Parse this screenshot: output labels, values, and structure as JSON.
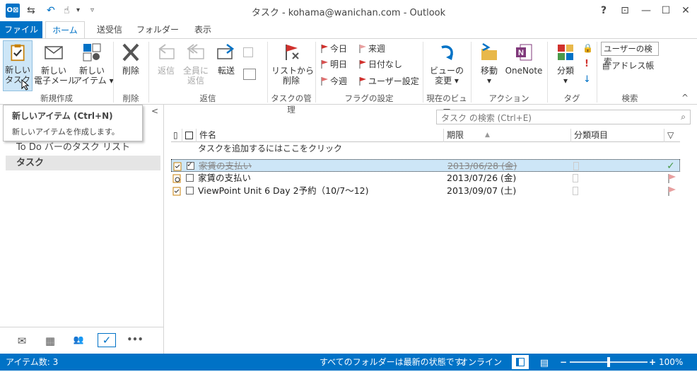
{
  "window": {
    "title": "タスク - kohama@wanichan.com - Outlook",
    "app_icon": "O⊠",
    "buttons": {
      "help": "?",
      "restore_ribbon": "⊡",
      "minimize": "—",
      "maximize": "☐",
      "close": "✕"
    }
  },
  "quick_access": {
    "sendrecv": "⇆",
    "undo": "↶",
    "touch": "☝",
    "more": "▾",
    "customize": "▿"
  },
  "tabs": [
    "ファイル",
    "ホーム",
    "送受信",
    "フォルダー",
    "表示"
  ],
  "ribbon": {
    "new_group": {
      "label": "新規作成",
      "new_task": "新しい\nタスク",
      "new_mail": "新しい\n電子メール",
      "new_item": "新しい\nアイテム ▾"
    },
    "delete_group": {
      "label": "削除",
      "delete": "削除"
    },
    "reply_group": {
      "label": "返信",
      "reply": "返信",
      "reply_all": "全員に\n返信",
      "forward": "転送"
    },
    "manage_group": {
      "label": "タスクの管理",
      "remove_from_list": "リストから\n削除"
    },
    "flag_group": {
      "label": "フラグの設定",
      "today": "今日",
      "tomorrow": "明日",
      "this_week": "今週",
      "next_week": "来週",
      "no_date": "日付なし",
      "custom": "ユーザー設定"
    },
    "view_group": {
      "label": "現在のビュー",
      "change_view": "ビューの\n変更 ▾"
    },
    "actions_group": {
      "label": "アクション",
      "move": "移動\n▾",
      "onenote": "OneNote"
    },
    "tags_group": {
      "label": "タグ",
      "categorize": "分類\n▾"
    },
    "search_group": {
      "label": "検索",
      "search_people": "ユーザーの検索",
      "address_book": "アドレス帳"
    },
    "collapse": "^"
  },
  "tooltip": {
    "title": "新しいアイテム (Ctrl+N)",
    "description": "新しいアイテムを作成します。"
  },
  "left_pane": {
    "collapse": "<",
    "items": [
      "To Do バーのタスク リスト",
      "タスク"
    ]
  },
  "nav_bar": [
    "✉",
    "▦",
    "👥",
    "✓",
    "•••"
  ],
  "search": {
    "placeholder": "タスク の検索 (Ctrl+E)",
    "icon": "search-icon"
  },
  "table": {
    "headers": {
      "subject": "件名",
      "due": "期限",
      "sort_icon": "▲",
      "category": "分類項目",
      "flag": "▽"
    },
    "add_row": "タスクを追加するにはここをクリック",
    "rows": [
      {
        "subject": "家賃の支払い",
        "due": "2013/06/28 (金)",
        "completed": true,
        "selected": true
      },
      {
        "subject": "家賃の支払い",
        "due": "2013/07/26 (金)",
        "completed": false,
        "selected": false
      },
      {
        "subject": "ViewPoint Unit 6 Day 2予約（10/7～12)",
        "due": "2013/09/07 (土)",
        "completed": false,
        "selected": false
      }
    ]
  },
  "status": {
    "count": "アイテム数: 3",
    "sync": "すべてのフォルダーは最新の状態です。",
    "online": "オンライン",
    "zoom": "100%",
    "zoom_value": 100
  },
  "colors": {
    "accent": "#0072c6",
    "flag_red": "#d0312d",
    "flag_light": "#e8a0a0",
    "selected_row": "#cde6f7"
  }
}
